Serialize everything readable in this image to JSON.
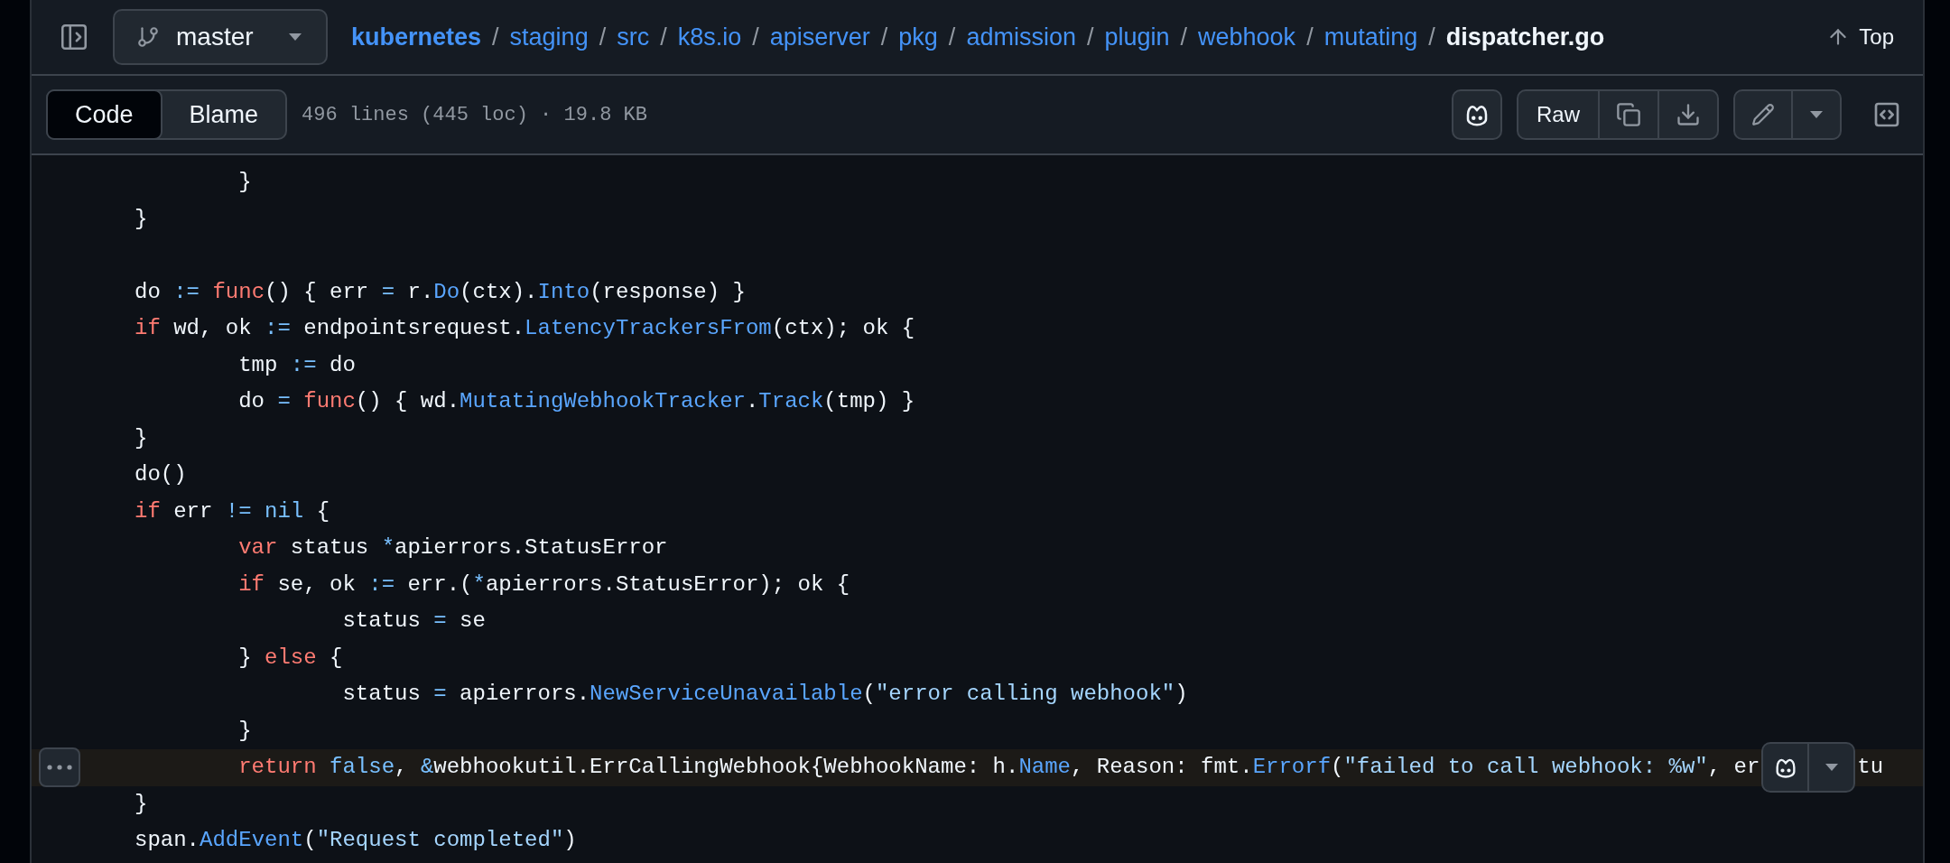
{
  "header": {
    "branch": "master",
    "breadcrumb": [
      {
        "label": "kubernetes",
        "kind": "repo",
        "separator": "/"
      },
      {
        "label": "staging",
        "kind": "folder",
        "separator": "/"
      },
      {
        "label": "src",
        "kind": "folder",
        "separator": "/"
      },
      {
        "label": "k8s.io",
        "kind": "folder",
        "separator": "/"
      },
      {
        "label": "apiserver",
        "kind": "folder",
        "separator": "/"
      },
      {
        "label": "pkg",
        "kind": "folder",
        "separator": "/"
      },
      {
        "label": "admission",
        "kind": "folder",
        "separator": "/"
      },
      {
        "label": "plugin",
        "kind": "folder",
        "separator": "/"
      },
      {
        "label": "webhook",
        "kind": "folder",
        "separator": "/"
      },
      {
        "label": "mutating",
        "kind": "folder",
        "separator": "/"
      },
      {
        "label": "dispatcher.go",
        "kind": "file"
      }
    ],
    "top_link": "Top"
  },
  "toolbar": {
    "tabs": [
      {
        "label": "Code",
        "selected": true
      },
      {
        "label": "Blame",
        "selected": false
      }
    ],
    "file_info": "496 lines (445 loc) · 19.8 KB",
    "raw_button": "Raw"
  },
  "code": {
    "lines": [
      {
        "highlighted": false,
        "tokens": [
          {
            "kind": "plain",
            "text": "\t}"
          }
        ]
      },
      {
        "highlighted": false,
        "tokens": [
          {
            "kind": "plain",
            "text": "}"
          }
        ]
      },
      {
        "highlighted": false
      },
      {
        "highlighted": false,
        "tokens": [
          {
            "kind": "plain",
            "text": "do "
          },
          {
            "kind": "operator",
            "text": ":= "
          },
          {
            "kind": "keyword",
            "text": "func"
          },
          {
            "kind": "plain",
            "text": "() { err "
          },
          {
            "kind": "operator",
            "text": "="
          },
          {
            "kind": "plain",
            "text": " r."
          },
          {
            "kind": "function",
            "text": "Do"
          },
          {
            "kind": "plain",
            "text": "(ctx)."
          },
          {
            "kind": "function",
            "text": "Into"
          },
          {
            "kind": "plain",
            "text": "(response) }"
          }
        ]
      },
      {
        "highlighted": false,
        "tokens": [
          {
            "kind": "keyword",
            "text": "if"
          },
          {
            "kind": "plain",
            "text": " wd, ok "
          },
          {
            "kind": "operator",
            "text": ":="
          },
          {
            "kind": "plain",
            "text": " endpointsrequest."
          },
          {
            "kind": "function",
            "text": "LatencyTrackersFrom"
          },
          {
            "kind": "plain",
            "text": "(ctx); ok {"
          }
        ]
      },
      {
        "highlighted": false,
        "tokens": [
          {
            "kind": "plain",
            "text": "\ttmp "
          },
          {
            "kind": "operator",
            "text": ":="
          },
          {
            "kind": "plain",
            "text": " do"
          }
        ]
      },
      {
        "highlighted": false,
        "tokens": [
          {
            "kind": "plain",
            "text": "\tdo "
          },
          {
            "kind": "operator",
            "text": "= "
          },
          {
            "kind": "keyword",
            "text": "func"
          },
          {
            "kind": "plain",
            "text": "() { wd."
          },
          {
            "kind": "function",
            "text": "MutatingWebhookTracker"
          },
          {
            "kind": "plain",
            "text": "."
          },
          {
            "kind": "function",
            "text": "Track"
          },
          {
            "kind": "plain",
            "text": "(tmp) }"
          }
        ]
      },
      {
        "highlighted": false,
        "tokens": [
          {
            "kind": "plain",
            "text": "}"
          }
        ]
      },
      {
        "highlighted": false,
        "tokens": [
          {
            "kind": "plain",
            "text": "do()"
          }
        ]
      },
      {
        "highlighted": false,
        "tokens": [
          {
            "kind": "keyword",
            "text": "if"
          },
          {
            "kind": "plain",
            "text": " err "
          },
          {
            "kind": "operator",
            "text": "!= "
          },
          {
            "kind": "constant",
            "text": "nil"
          },
          {
            "kind": "plain",
            "text": " {"
          }
        ]
      },
      {
        "highlighted": false,
        "tokens": [
          {
            "kind": "keyword",
            "text": "\tvar"
          },
          {
            "kind": "plain",
            "text": " status "
          },
          {
            "kind": "operator",
            "text": "*"
          },
          {
            "kind": "plain",
            "text": "apierrors.StatusError"
          }
        ]
      },
      {
        "highlighted": false,
        "tokens": [
          {
            "kind": "keyword",
            "text": "\tif"
          },
          {
            "kind": "plain",
            "text": " se, ok "
          },
          {
            "kind": "operator",
            "text": ":="
          },
          {
            "kind": "plain",
            "text": " err.("
          },
          {
            "kind": "operator",
            "text": "*"
          },
          {
            "kind": "plain",
            "text": "apierrors.StatusError); ok {"
          }
        ]
      },
      {
        "highlighted": false,
        "tokens": [
          {
            "kind": "plain",
            "text": "\t\tstatus "
          },
          {
            "kind": "operator",
            "text": "="
          },
          {
            "kind": "plain",
            "text": " se"
          }
        ]
      },
      {
        "highlighted": false,
        "tokens": [
          {
            "kind": "plain",
            "text": "\t} "
          },
          {
            "kind": "keyword",
            "text": "else"
          },
          {
            "kind": "plain",
            "text": " {"
          }
        ]
      },
      {
        "highlighted": false,
        "tokens": [
          {
            "kind": "plain",
            "text": "\t\tstatus "
          },
          {
            "kind": "operator",
            "text": "="
          },
          {
            "kind": "plain",
            "text": " apierrors."
          },
          {
            "kind": "function",
            "text": "NewServiceUnavailable"
          },
          {
            "kind": "plain",
            "text": "("
          },
          {
            "kind": "string",
            "text": "\"error calling webhook\""
          },
          {
            "kind": "plain",
            "text": ")"
          }
        ]
      },
      {
        "highlighted": false,
        "tokens": [
          {
            "kind": "plain",
            "text": "\t}"
          }
        ]
      },
      {
        "highlighted": true,
        "copilot_menu": true,
        "tokens": [
          {
            "kind": "keyword",
            "text": "\treturn "
          },
          {
            "kind": "constant",
            "text": "false"
          },
          {
            "kind": "plain",
            "text": ", "
          },
          {
            "kind": "operator",
            "text": "&"
          },
          {
            "kind": "plain",
            "text": "webhookutil.ErrCallingWebhook{WebhookName: h."
          },
          {
            "kind": "function",
            "text": "Name"
          },
          {
            "kind": "plain",
            "text": ", Reason: fmt."
          },
          {
            "kind": "function",
            "text": "Errorf"
          },
          {
            "kind": "plain",
            "text": "("
          },
          {
            "kind": "string",
            "text": "\"failed to call webhook: %w\""
          },
          {
            "kind": "plain",
            "text": ", er"
          }
        ],
        "tokens_after": [
          {
            "kind": "plain",
            "text": "tu"
          }
        ]
      },
      {
        "highlighted": false,
        "tokens": [
          {
            "kind": "plain",
            "text": "}"
          }
        ]
      },
      {
        "highlighted": false,
        "tokens": [
          {
            "kind": "plain",
            "text": "span."
          },
          {
            "kind": "function",
            "text": "AddEvent"
          },
          {
            "kind": "plain",
            "text": "("
          },
          {
            "kind": "string",
            "text": "\"Request completed\""
          },
          {
            "kind": "plain",
            "text": ")"
          }
        ]
      }
    ]
  }
}
